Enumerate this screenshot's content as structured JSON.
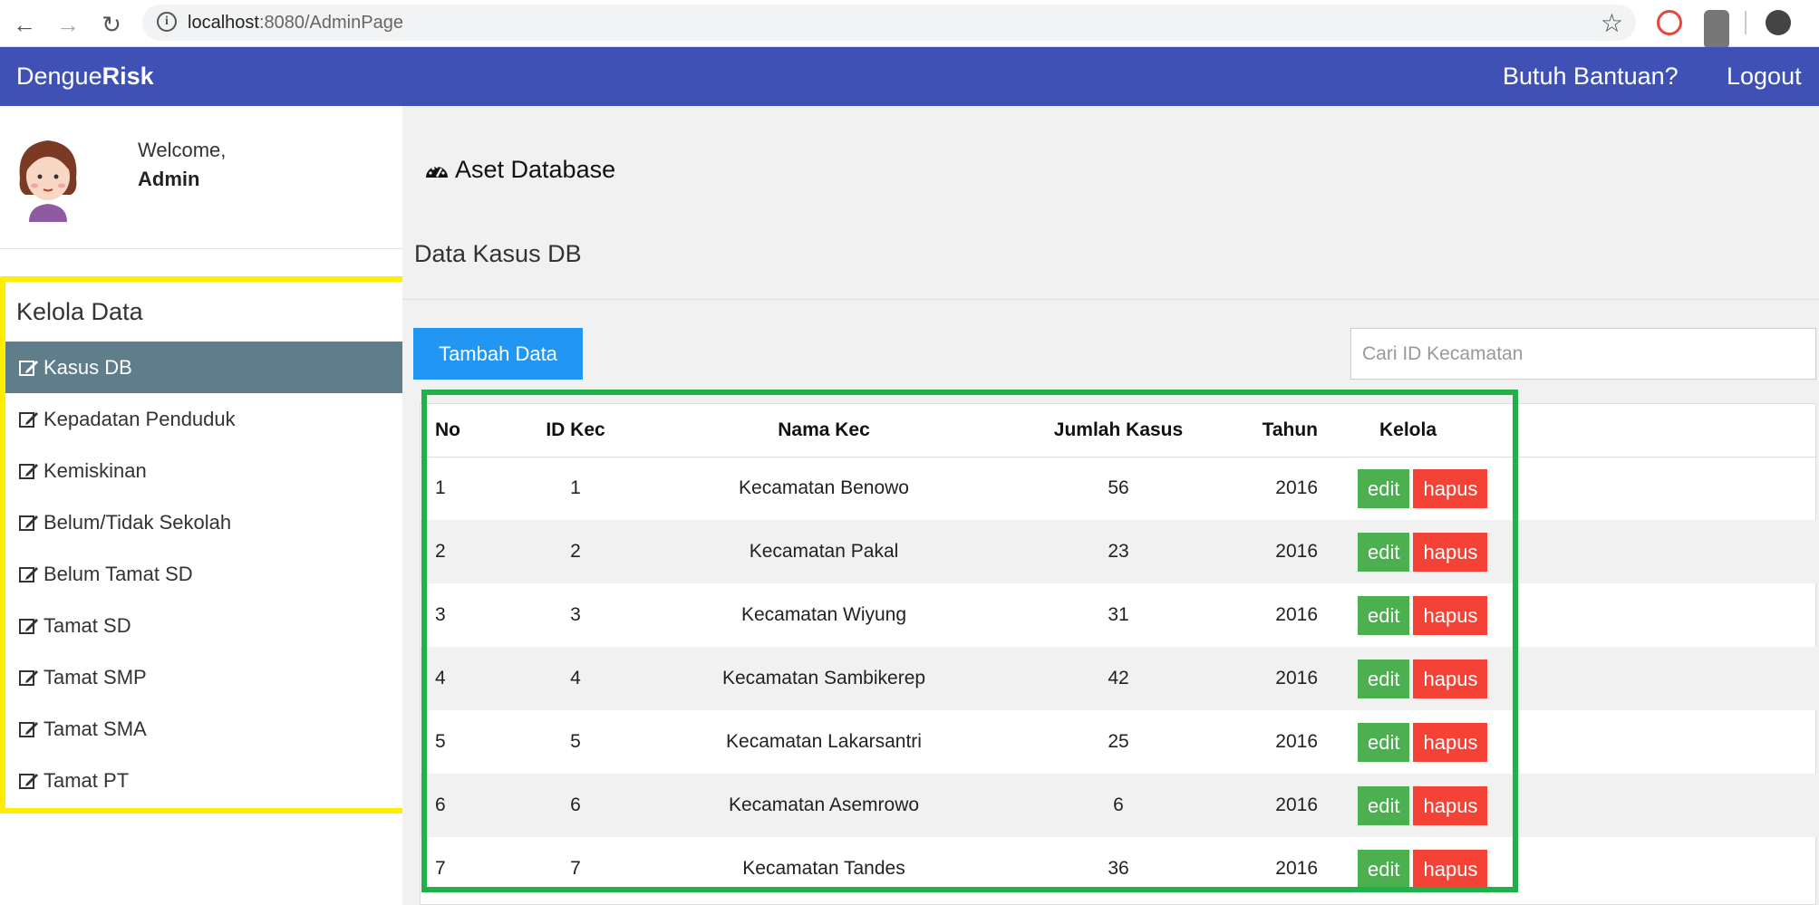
{
  "browser": {
    "url_host": "localhost",
    "url_rest": ":8080/AdminPage"
  },
  "navbar": {
    "brand_light": "Dengue",
    "brand_bold": "Risk",
    "help": "Butuh Bantuan?",
    "logout": "Logout"
  },
  "sidebar": {
    "welcome": "Welcome,",
    "user": "Admin",
    "section_title": "Kelola Data",
    "items": [
      {
        "label": "Kasus DB"
      },
      {
        "label": "Kepadatan Penduduk"
      },
      {
        "label": "Kemiskinan"
      },
      {
        "label": "Belum/Tidak Sekolah"
      },
      {
        "label": "Belum Tamat SD"
      },
      {
        "label": "Tamat SD"
      },
      {
        "label": "Tamat SMP"
      },
      {
        "label": "Tamat SMA"
      },
      {
        "label": "Tamat PT"
      }
    ]
  },
  "main": {
    "title": "Aset Database",
    "subtitle": "Data Kasus DB",
    "add_button": "Tambah Data",
    "search_placeholder": "Cari ID Kecamatan",
    "columns": [
      "No",
      "ID Kec",
      "Nama Kec",
      "Jumlah Kasus",
      "Tahun",
      "Kelola"
    ],
    "edit_label": "edit",
    "delete_label": "hapus",
    "rows": [
      {
        "no": "1",
        "id": "1",
        "nama": "Kecamatan Benowo",
        "jumlah": "56",
        "tahun": "2016"
      },
      {
        "no": "2",
        "id": "2",
        "nama": "Kecamatan Pakal",
        "jumlah": "23",
        "tahun": "2016"
      },
      {
        "no": "3",
        "id": "3",
        "nama": "Kecamatan Wiyung",
        "jumlah": "31",
        "tahun": "2016"
      },
      {
        "no": "4",
        "id": "4",
        "nama": "Kecamatan Sambikerep",
        "jumlah": "42",
        "tahun": "2016"
      },
      {
        "no": "5",
        "id": "5",
        "nama": "Kecamatan Lakarsantri",
        "jumlah": "25",
        "tahun": "2016"
      },
      {
        "no": "6",
        "id": "6",
        "nama": "Kecamatan Asemrowo",
        "jumlah": "6",
        "tahun": "2016"
      },
      {
        "no": "7",
        "id": "7",
        "nama": "Kecamatan Tandes",
        "jumlah": "36",
        "tahun": "2016"
      }
    ]
  },
  "colors": {
    "navbar": "#3f51b5",
    "active_item": "#607d8b",
    "add_button": "#2196f3",
    "edit": "#4caf50",
    "delete": "#f44336",
    "highlight_sidebar": "#ffee00",
    "highlight_table": "#21b14b"
  }
}
